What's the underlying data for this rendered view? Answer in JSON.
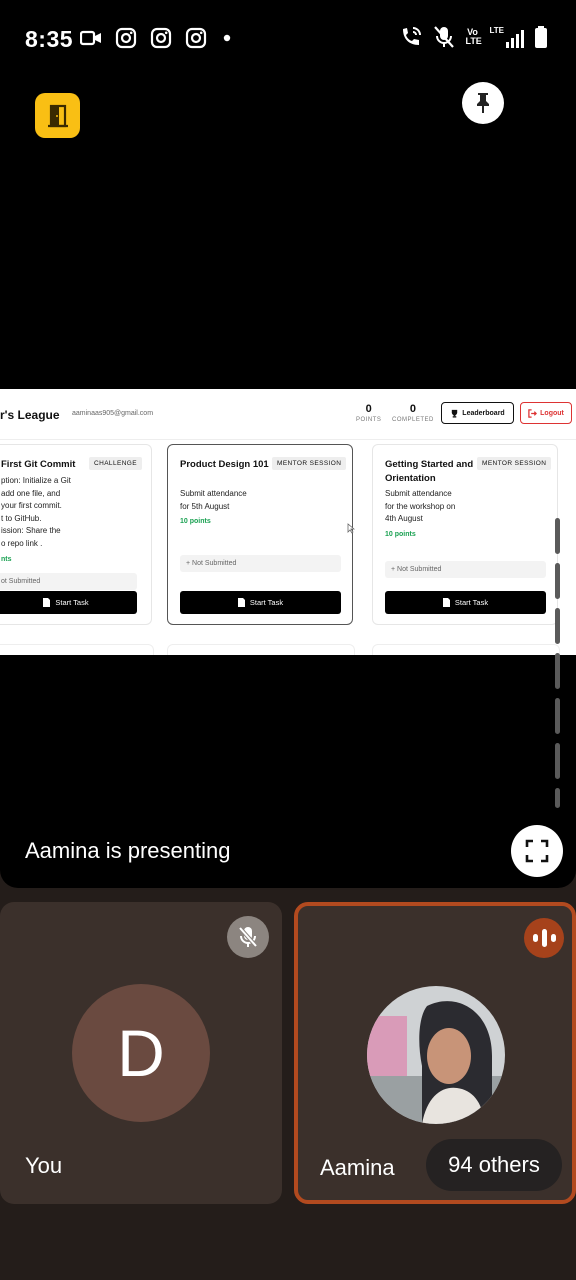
{
  "status_bar": {
    "time": "8:35",
    "left_icons": [
      "video-icon",
      "instagram-icon",
      "instagram-icon",
      "instagram-icon",
      "dot-icon"
    ],
    "right_icons": [
      "wifi-calling-icon",
      "mic-muted-icon",
      "volte-icon",
      "lte-signal-icon",
      "battery-icon"
    ],
    "volte_label": "Vo LTE",
    "lte_label": "LTE"
  },
  "meeting": {
    "presenting_label": "Aamina is presenting",
    "others_label": "94 others"
  },
  "shared_screen": {
    "app_title": "r's League",
    "user_email": "aaminaas905@gmail.com",
    "points_value": "0",
    "points_label": "POINTS",
    "completed_value": "0",
    "completed_label": "COMPLETED",
    "leaderboard_label": "Leaderboard",
    "logout_label": "Logout",
    "tasks": [
      {
        "title": "First Git Commit",
        "badge": "CHALLENGE",
        "description_lines": [
          "ption: Initialize a Git",
          "add one file, and",
          "your first commit.",
          "t to GitHub.",
          "ission: Share the",
          "o repo link ."
        ],
        "points": "nts",
        "status": "ot Submitted",
        "button": "Start Task"
      },
      {
        "title": "Product Design 101",
        "badge": "MENTOR SESSION",
        "description_lines": [
          "Submit attendance",
          "for 5th August"
        ],
        "points": "10 points",
        "status": "+ Not Submitted",
        "button": "Start Task"
      },
      {
        "title": "Getting Started and Orientation",
        "badge": "MENTOR SESSION",
        "description_lines": [
          "Submit attendance",
          "for the workshop on",
          "4th August"
        ],
        "points": "10 points",
        "status": "+ Not Submitted",
        "button": "Start Task"
      }
    ]
  },
  "participants": [
    {
      "name": "You",
      "initial": "D",
      "mic": "muted"
    },
    {
      "name": "Aamina",
      "mic": "speaking"
    }
  ],
  "colors": {
    "door_button": "#f9bf14",
    "speaking_border": "#b24a1f",
    "tile_bg": "#3b302b",
    "points_green": "#1aa152",
    "logout_red": "#dd3333"
  }
}
